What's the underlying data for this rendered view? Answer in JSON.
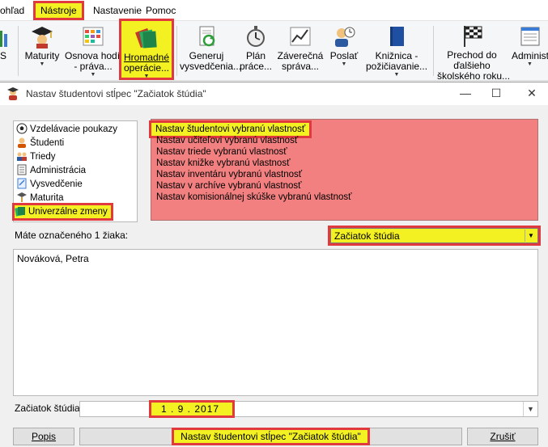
{
  "menubar": {
    "items": [
      "ohľad",
      "Nástroje",
      "Nastavenie",
      "Pomoc"
    ]
  },
  "ribbon": {
    "partial_label": "S",
    "buttons": [
      {
        "label1": "Maturity",
        "label2": "",
        "has_arrow": true
      },
      {
        "label1": "Osnova hodín",
        "label2": "- práva...",
        "has_arrow": true
      },
      {
        "label1": "Hromadné",
        "label2": "operácie...",
        "has_arrow": true
      },
      {
        "label1": "Generuj",
        "label2": "vysvedčenia...",
        "has_arrow": false
      },
      {
        "label1": "Plán",
        "label2": "práce...",
        "has_arrow": false
      },
      {
        "label1": "Záverečná",
        "label2": "správa...",
        "has_arrow": false
      },
      {
        "label1": "Poslať",
        "label2": "",
        "has_arrow": true
      },
      {
        "label1": "Knižnica -",
        "label2": "požičiavanie...",
        "has_arrow": true
      },
      {
        "label1": "Prechod do",
        "label2": "ďalšieho",
        "label3": "školského roku...",
        "has_arrow": false
      },
      {
        "label1": "Administ",
        "label2": "",
        "has_arrow": true
      }
    ]
  },
  "dialog": {
    "title": "Nastav študentovi stĺpec \"Začiatok štúdia\"",
    "categories": [
      {
        "label": "Vzdelávacie poukazy",
        "icon": "soccer-ball-icon"
      },
      {
        "label": "Študenti",
        "icon": "student-icon"
      },
      {
        "label": "Triedy",
        "icon": "class-icon"
      },
      {
        "label": "Administrácia",
        "icon": "administration-icon"
      },
      {
        "label": "Vysvedčenie",
        "icon": "certificate-icon"
      },
      {
        "label": "Maturita",
        "icon": "graduation-icon"
      },
      {
        "label": "Univerzálne zmeny",
        "icon": "universal-changes-icon"
      }
    ],
    "actions": [
      "Nastav študentovi vybranú vlastnosť",
      "Nastav učiteľovi vybranú vlastnosť",
      "Nastav triede vybranú vlastnosť",
      "Nastav knižke vybranú vlastnosť",
      "Nastav inventáru vybranú vlastnosť",
      "Nastav v archíve vybranú vlastnosť",
      "Nastav komisionálnej skúške vybranú vlastnosť"
    ],
    "selection_label": "Máte označeného 1 žiaka:",
    "property_value": "Začiatok štúdia",
    "students": [
      "Nováková, Petra"
    ],
    "date_label": "Začiatok štúdia:",
    "date_value": "1 . 9 . 2017",
    "help_button": "Popis",
    "apply_button": "Nastav študentovi stĺpec \"Začiatok štúdia\"",
    "cancel_button": "Zrušiť"
  },
  "colors": {
    "highlight_yellow": "#f4f123",
    "highlight_red": "#e0393e",
    "action_list_bg": "#f28080"
  }
}
